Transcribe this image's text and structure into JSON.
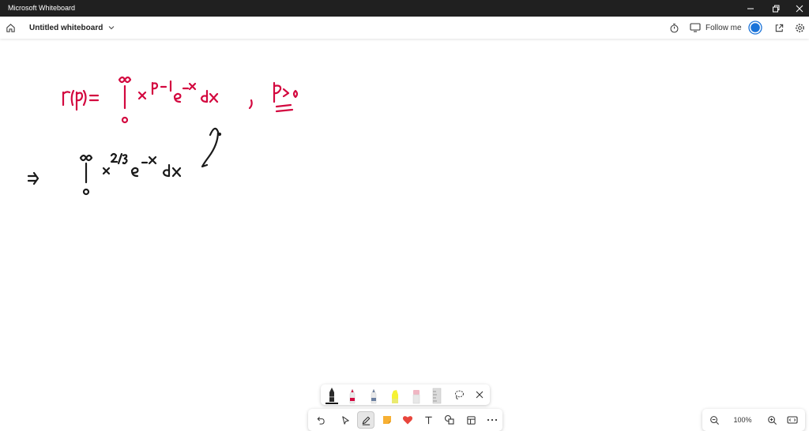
{
  "titlebar": {
    "title": "Microsoft Whiteboard",
    "minimize_icon": "minimize-icon",
    "restore_icon": "restore-icon",
    "close_icon": "close-icon"
  },
  "appbar": {
    "home_icon": "home-icon",
    "board_name": "Untitled whiteboard",
    "timer_icon": "timer-icon",
    "follow_label": "Follow me",
    "share_icon": "share-icon",
    "settings_icon": "gear-icon",
    "avatar_color": "#1a73d9"
  },
  "ink": {
    "primary_color": "#d3083f",
    "secondary_color": "#1a1a1a",
    "strokes_desc": "handwritten gamma function definition and integral"
  },
  "toolbox": {
    "pens": [
      {
        "name": "black-pen",
        "color": "#1a1a1a",
        "selected": true
      },
      {
        "name": "red-pen",
        "color": "#d3083f"
      },
      {
        "name": "blue-pen",
        "color": "#6a7fa0"
      },
      {
        "name": "highlighter",
        "color": "#f5f234"
      },
      {
        "name": "eraser",
        "color": "#f0b6c3"
      },
      {
        "name": "ruler",
        "color": "#cfcfcf"
      }
    ],
    "lasso_icon": "lasso-icon",
    "close_icon": "close-icon"
  },
  "toolbar": {
    "undo_icon": "undo-icon",
    "select_icon": "pointer-icon",
    "pen_icon": "pen-icon",
    "note_icon": "sticky-note-icon",
    "reaction_icon": "heart-icon",
    "text_icon": "text-icon",
    "shapes_icon": "shapes-icon",
    "templates_icon": "templates-icon",
    "more_icon": "more-icon"
  },
  "zoom": {
    "zoom_out_icon": "zoom-out-icon",
    "value": "100%",
    "zoom_in_icon": "zoom-in-icon",
    "fit_icon": "fit-screen-icon"
  }
}
